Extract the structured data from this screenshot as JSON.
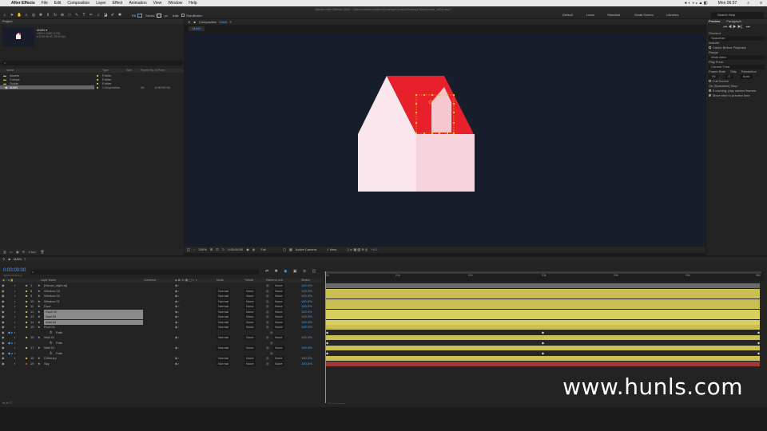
{
  "menubar": {
    "app": "After Effects",
    "items": [
      "File",
      "Edit",
      "Composition",
      "Layer",
      "Effect",
      "Animation",
      "View",
      "Window",
      "Help"
    ],
    "time": "Mon 06:57"
  },
  "title_path": "Adobe After Effects 2020 - /Users/nelas/untitled/Desktop/House/Working Files/house_v003.aep *",
  "toolbar": {
    "fill_label": "Fill",
    "stroke_label": "Stroke",
    "stroke_px": "px",
    "add_label": "Add:",
    "rotobezier_label": "RotoBezier",
    "workspaces": [
      "Default",
      "Learn",
      "Standard",
      "Small Screen",
      "Libraries"
    ],
    "search_help": "Search Help"
  },
  "project": {
    "tab": "Project",
    "selected_name": "MAIN ▾",
    "info1": "1024 x 1080 (1.00)",
    "info2": "Δ 0:00:06:00, 25.00 fps",
    "columns": [
      "Name",
      "Type",
      "Size",
      "Frame Ra...",
      "In Point"
    ],
    "rows": [
      {
        "name": "Assets",
        "type": "Folder",
        "size": "",
        "fr": "",
        "in": ""
      },
      {
        "name": "Comps",
        "type": "Folder",
        "size": "",
        "fr": "",
        "in": ""
      },
      {
        "name": "Solids",
        "type": "Folder",
        "size": "",
        "fr": "",
        "in": ""
      },
      {
        "name": "MAIN",
        "type": "Composition",
        "size": "",
        "fr": "25",
        "in": "0:00:00:00"
      }
    ],
    "bpc": "8 bpc"
  },
  "composition": {
    "tab_label": "Composition",
    "tab_name": "MAIN",
    "sub_tab": "MAIN",
    "zoom": "200%",
    "time": "0:00:00:00",
    "resolution": "Full",
    "camera": "Active Camera",
    "view": "1 View",
    "exposure": "+0.0"
  },
  "right_panel": {
    "tabs": [
      "Preview",
      "Paragraph"
    ],
    "shortcut_label": "Shortcut",
    "shortcut_value": "Spacebar",
    "include_label": "Include:",
    "cache_label": "Cache Before Playback",
    "range_label": "Range",
    "range_value": "Work Area",
    "play_from_label": "Play From",
    "play_from_value": "Current Time",
    "frame_rate_label": "Frame Rate",
    "skip_label": "Skip",
    "resolution_label": "Resolution",
    "frame_rate_value": "25",
    "skip_value": "0",
    "resolution_value": "Auto",
    "full_screen": "Full Screen",
    "on_stop_label": "On (Spacebar) Stop:",
    "if_caching": "If caching, play cached frames",
    "move_time": "Move time to preview time"
  },
  "timeline": {
    "tab": "MAIN",
    "timecode": "0:00:00:00",
    "timecode_sub": "00000 (25.00 fps)",
    "columns": {
      "name": "Layer Name",
      "comment": "Comment",
      "mode": "Mode",
      "trkmat": "TrkMat",
      "parent": "Parent & Link",
      "stretch": "Stretch"
    },
    "ruler": [
      "0s",
      "01s",
      "02s",
      "03s",
      "04s",
      "05s",
      "06s"
    ],
    "layers": [
      {
        "num": "1",
        "name": "[House_night.ai]",
        "mode": "",
        "trk": "",
        "parent": "None",
        "stretch": "100.0%",
        "selected": false
      },
      {
        "num": "8",
        "name": "Window 03",
        "mode": "Normal",
        "trk": "None",
        "parent": "None",
        "stretch": "100.0%",
        "selected": false
      },
      {
        "num": "9",
        "name": "Window 02",
        "mode": "Normal",
        "trk": "None",
        "parent": "None",
        "stretch": "100.0%",
        "selected": false
      },
      {
        "num": "10",
        "name": "Window 01",
        "mode": "Normal",
        "trk": "None",
        "parent": "None",
        "stretch": "100.0%",
        "selected": false
      },
      {
        "num": "11",
        "name": "Door",
        "mode": "Normal",
        "trk": "None",
        "parent": "None",
        "stretch": "100.0%",
        "selected": false
      },
      {
        "num": "12",
        "name": "Roof 02",
        "mode": "Normal",
        "trk": "None",
        "parent": "None",
        "stretch": "100.0%",
        "selected": true
      },
      {
        "num": "13",
        "name": "Wall 03",
        "mode": "Normal",
        "trk": "None",
        "parent": "None",
        "stretch": "100.0%",
        "selected": true
      },
      {
        "num": "14",
        "name": "Wall 04",
        "mode": "Normal",
        "trk": "None",
        "parent": "None",
        "stretch": "100.0%",
        "selected": true
      },
      {
        "num": "15",
        "name": "Roof 01",
        "mode": "Normal",
        "trk": "None",
        "parent": "None",
        "stretch": "100.0%",
        "selected": false
      },
      {
        "num": "",
        "name": "Path",
        "mode": "",
        "trk": "",
        "parent": "",
        "stretch": "",
        "selected": false,
        "sub": true
      },
      {
        "num": "16",
        "name": "Wall 01",
        "mode": "Normal",
        "trk": "None",
        "parent": "None",
        "stretch": "100.0%",
        "selected": false
      },
      {
        "num": "",
        "name": "Path",
        "mode": "",
        "trk": "",
        "parent": "",
        "stretch": "",
        "selected": false,
        "sub": true
      },
      {
        "num": "17",
        "name": "Wall 01",
        "mode": "Normal",
        "trk": "None",
        "parent": "None",
        "stretch": "100.0%",
        "selected": false
      },
      {
        "num": "",
        "name": "Path",
        "mode": "",
        "trk": "",
        "parent": "",
        "stretch": "",
        "selected": false,
        "sub": true
      },
      {
        "num": "18",
        "name": "Chimney",
        "mode": "Normal",
        "trk": "None",
        "parent": "None",
        "stretch": "100.0%",
        "selected": false
      },
      {
        "num": "19",
        "name": "Sky",
        "mode": "Normal",
        "trk": "None",
        "parent": "None",
        "stretch": "100.0%",
        "selected": false
      }
    ]
  },
  "watermark": "www.hunls.com",
  "colors": {
    "roof": "#e8202b",
    "wall_light": "#fae6ec",
    "wall_shade": "#f4d3dc",
    "comp_bg": "#171d2a",
    "track_yellow": "#c9bf52",
    "track_red": "#9c3a35",
    "accent": "#3a8fd9"
  }
}
